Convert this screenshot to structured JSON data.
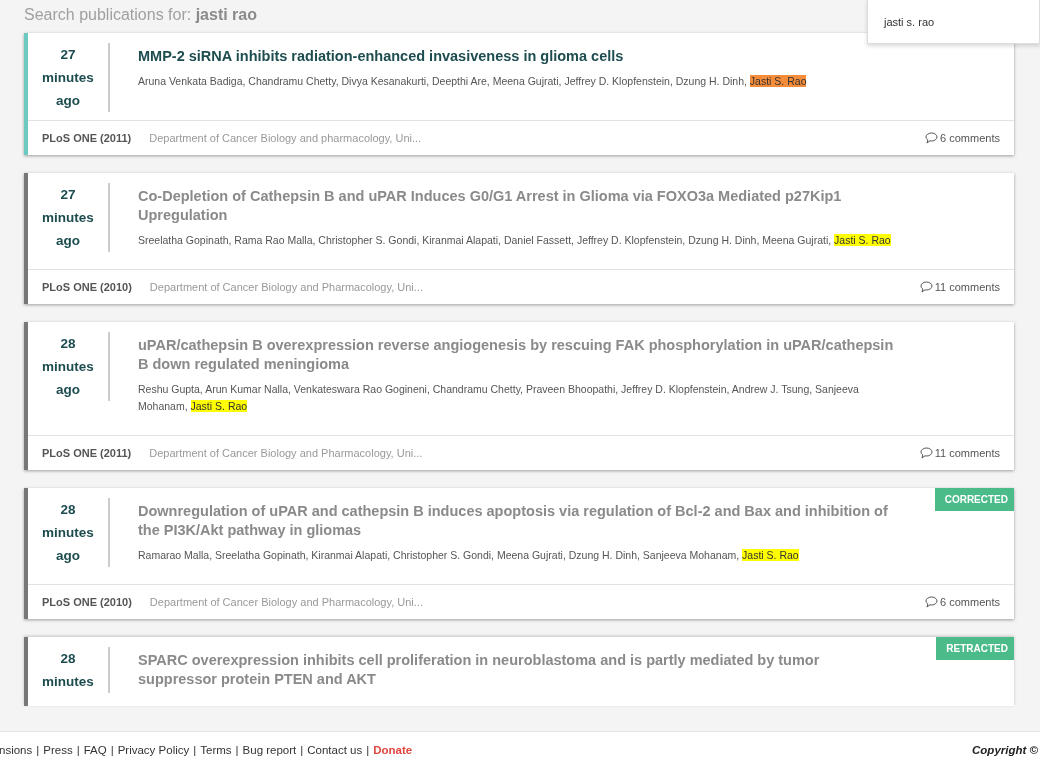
{
  "search": {
    "label": "Search publications for:",
    "query": "jasti rao"
  },
  "suggestion": {
    "text": "jasti s. rao"
  },
  "publications": [
    {
      "selected": true,
      "time": {
        "number": "27",
        "unit": "minutes",
        "suffix": "ago"
      },
      "title": "MMP-2 siRNA inhibits radiation-enhanced invasiveness in glioma cells",
      "authors": "Aruna Venkata Badiga, Chandramu Chetty, Divya Kesanakurti, Deepthi Are, Meena Gujrati, Jeffrey D. Klopfenstein, Dzung H. Dinh, ",
      "highlight": "Jasti S. Rao",
      "journal": "PLoS ONE (2011)",
      "department": "Department of Cancer Biology and pharmacology, Uni...",
      "comments": "6 comments"
    },
    {
      "selected": false,
      "time": {
        "number": "27",
        "unit": "minutes",
        "suffix": "ago"
      },
      "title": "Co-Depletion of Cathepsin B and uPAR Induces G0/G1 Arrest in Glioma via FOXO3a Mediated p27Kip1 Upregulation",
      "authors": "Sreelatha Gopinath, Rama Rao Malla, Christopher S. Gondi, Kiranmai Alapati, Daniel Fassett, Jeffrey D. Klopfenstein, Dzung H. Dinh, Meena Gujrati, ",
      "highlight": "Jasti S. Rao",
      "journal": "PLoS ONE (2010)",
      "department": "Department of Cancer Biology and Pharmacology, Uni...",
      "comments": "11 comments"
    },
    {
      "selected": false,
      "time": {
        "number": "28",
        "unit": "minutes",
        "suffix": "ago"
      },
      "title": "uPAR/cathepsin B overexpression reverse angiogenesis by rescuing FAK phosphorylation in uPAR/cathepsin B down regulated meningioma",
      "authors": "Reshu Gupta, Arun Kumar Nalla, Venkateswara Rao Gogineni, Chandramu Chetty, Praveen Bhoopathi, Jeffrey D. Klopfenstein, Andrew J. Tsung, Sanjeeva Mohanam, ",
      "highlight": "Jasti S. Rao",
      "journal": "PLoS ONE (2011)",
      "department": "Department of Cancer Biology and Pharmacology, Uni...",
      "comments": "11 comments"
    },
    {
      "selected": false,
      "badge": "CORRECTED",
      "time": {
        "number": "28",
        "unit": "minutes",
        "suffix": "ago"
      },
      "title": "Downregulation of uPAR and cathepsin B induces apoptosis via regulation of Bcl-2 and Bax and inhibition of the PI3K/Akt pathway in gliomas",
      "authors": "Ramarao Malla, Sreelatha Gopinath, Kiranmai Alapati, Christopher S. Gondi, Meena Gujrati, Dzung H. Dinh, Sanjeeva Mohanam, ",
      "highlight": "Jasti S. Rao",
      "journal": "PLoS ONE (2010)",
      "department": "Department of Cancer Biology and Pharmacology, Uni...",
      "comments": "6 comments"
    },
    {
      "selected": false,
      "badge": "RETRACTED",
      "time": {
        "number": "28",
        "unit": "minutes"
      },
      "title": "SPARC overexpression inhibits cell proliferation in neuroblastoma and is partly mediated by tumor suppressor protein PTEN and AKT"
    }
  ],
  "footer": {
    "links": [
      {
        "label": "nsions",
        "kind": "plain"
      },
      {
        "label": "Press",
        "kind": "plain"
      },
      {
        "label": "FAQ",
        "kind": "plain"
      },
      {
        "label": "Privacy Policy",
        "kind": "plain"
      },
      {
        "label": "Terms",
        "kind": "plain"
      },
      {
        "label": "Bug report",
        "kind": "plain"
      },
      {
        "label": "Contact us",
        "kind": "plain"
      },
      {
        "label": "Donate",
        "kind": "donate"
      }
    ],
    "separator": "|",
    "copyright": "Copyright ©"
  }
}
